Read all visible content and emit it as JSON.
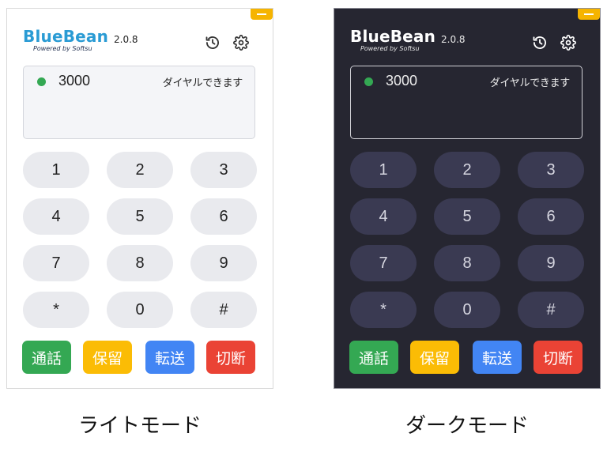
{
  "app": {
    "name": "BlueBean",
    "tagline": "Powered by Softsu",
    "version": "2.0.8"
  },
  "status": {
    "extension": "3000",
    "text": "ダイヤルできます",
    "dot_color": "#34a853"
  },
  "keypad": {
    "keys": [
      "1",
      "2",
      "3",
      "4",
      "5",
      "6",
      "7",
      "8",
      "9",
      "*",
      "0",
      "#"
    ]
  },
  "actions": {
    "call": {
      "label": "通話",
      "color": "#34a853"
    },
    "hold": {
      "label": "保留",
      "color": "#fbbc05"
    },
    "transfer": {
      "label": "転送",
      "color": "#4285f4"
    },
    "hangup": {
      "label": "切断",
      "color": "#ea4335"
    }
  },
  "icons": {
    "history": "history-icon",
    "settings": "gear-icon",
    "minimize": "minimize-icon"
  },
  "themes": {
    "light": {
      "caption": "ライトモード",
      "background": "#ffffff"
    },
    "dark": {
      "caption": "ダークモード",
      "background": "#262631"
    }
  }
}
